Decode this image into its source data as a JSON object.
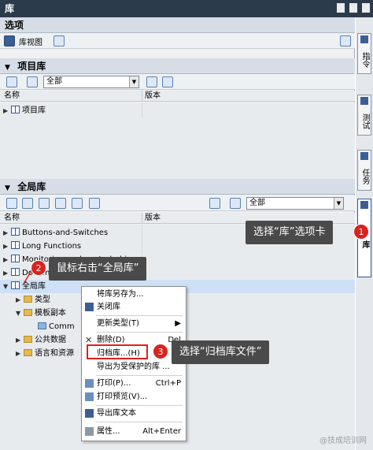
{
  "window_title": "库",
  "options": {
    "header": "选项",
    "lib_view_label": "库视图"
  },
  "project_lib": {
    "header": "项目库",
    "filter": "全部",
    "col_name": "名称",
    "col_version": "版本",
    "items": [
      {
        "label": "项目库"
      }
    ]
  },
  "global_lib": {
    "header": "全局库",
    "filter": "全部",
    "col_name": "名称",
    "col_version": "版本",
    "items": [
      {
        "label": "Buttons-and-Switches"
      },
      {
        "label": "Long Functions"
      },
      {
        "label": "Monitoring-and-control-obj"
      },
      {
        "label": "Documentation templates"
      },
      {
        "label": "全局库"
      },
      {
        "label": "类型"
      },
      {
        "label": "模板副本"
      },
      {
        "label": "Comm"
      },
      {
        "label": "公共数据"
      },
      {
        "label": "语言和资源"
      }
    ]
  },
  "context_menu": {
    "items": [
      {
        "label": "将库另存为...",
        "shortcut": ""
      },
      {
        "label": "关闭库",
        "shortcut": ""
      },
      {
        "label": "更新类型(T)",
        "shortcut": "▶"
      },
      {
        "label": "删除(D)",
        "shortcut": "Del"
      },
      {
        "label": "归档库...(H)",
        "shortcut": ""
      },
      {
        "label": "导出为受保护的库 ...",
        "shortcut": ""
      },
      {
        "label": "打印(P)...",
        "shortcut": "Ctrl+P"
      },
      {
        "label": "打印预览(V)...",
        "shortcut": ""
      },
      {
        "label": "导出库文本",
        "shortcut": ""
      },
      {
        "label": "属性...",
        "shortcut": "Alt+Enter"
      }
    ]
  },
  "side_tabs": [
    "指令",
    "测试",
    "任务",
    "库"
  ],
  "callouts": {
    "c1": {
      "num": "1",
      "text": "选择“库”选项卡"
    },
    "c2": {
      "num": "2",
      "text": "鼠标右击“全局库”"
    },
    "c3": {
      "num": "3",
      "text": "选择“归档库文件”"
    }
  },
  "watermark": "@技成培训网",
  "colors": {
    "title_bar": "#2c3b4c",
    "highlight": "#e0201c",
    "callout_bg": "#4a4a4a"
  }
}
